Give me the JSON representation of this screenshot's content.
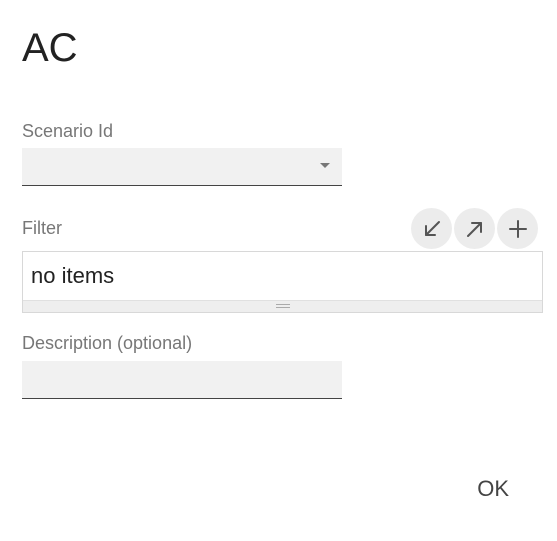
{
  "dialog": {
    "title": "AC"
  },
  "scenario": {
    "label": "Scenario Id",
    "value": ""
  },
  "filter": {
    "label": "Filter",
    "content": "no items",
    "actions": [
      {
        "icon": "arrow-down-left-icon"
      },
      {
        "icon": "arrow-up-right-icon"
      },
      {
        "icon": "plus-icon"
      }
    ]
  },
  "description": {
    "label": "Description (optional)",
    "value": ""
  },
  "footer": {
    "ok_label": "OK"
  },
  "colors": {
    "field_bg": "#f1f1f1",
    "underline": "#444444",
    "label": "#777777",
    "icon_bg": "#ececec"
  }
}
